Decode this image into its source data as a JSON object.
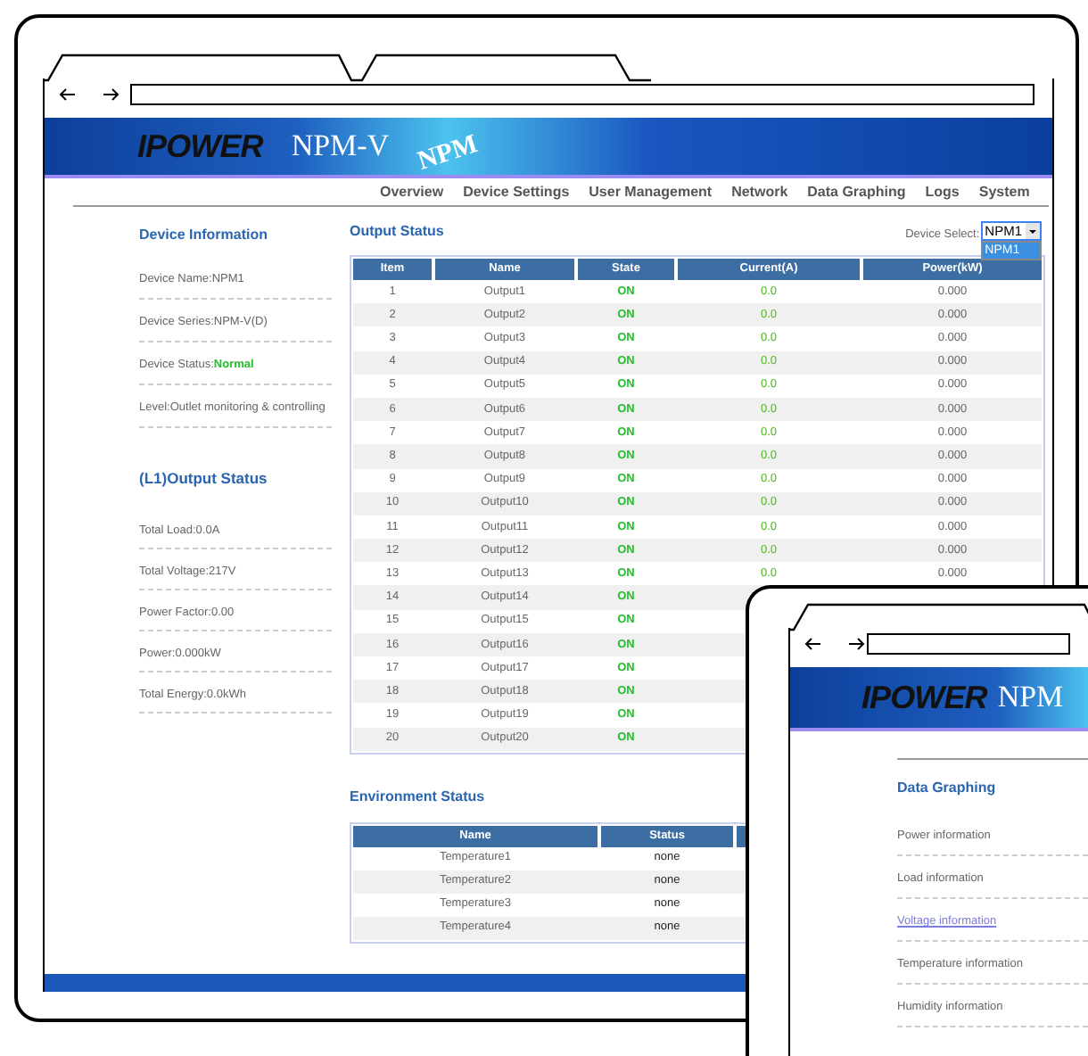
{
  "banner": {
    "logo": "IPOWER",
    "product": "NPM-V",
    "watermark": "NPM"
  },
  "nav": [
    "Overview",
    "Device Settings",
    "User Management",
    "Network",
    "Data Graphing",
    "Logs",
    "System"
  ],
  "device_info": {
    "title": "Device Information",
    "items": [
      "Device Name:NPM1",
      "Device Series:NPM-V(D)",
      "Device Status:**Normal**",
      "Level:Outlet monitoring & controlling"
    ]
  },
  "output_summary": {
    "title": "(L1)Output Status",
    "items": [
      "Total Load:0.0A",
      "Total Voltage:217V",
      "Power Factor:0.00",
      "Power:0.000kW",
      "Total Energy:0.0kWh"
    ]
  },
  "output_status": {
    "title": "Output Status",
    "device_select": {
      "label": "Device Select:",
      "value": "NPM1",
      "expanded": true,
      "options": [
        {
          "label": "NPM1",
          "selected": true
        }
      ]
    },
    "columns": [
      "Item",
      "Name",
      "State",
      "Current(A)",
      "Power(kW)"
    ],
    "rows": [
      {
        "item": "1",
        "name": "Output1",
        "state": "ON",
        "current": "0.0",
        "power": "0.000"
      },
      {
        "item": "2",
        "name": "Output2",
        "state": "ON",
        "current": "0.0",
        "power": "0.000"
      },
      {
        "item": "3",
        "name": "Output3",
        "state": "ON",
        "current": "0.0",
        "power": "0.000"
      },
      {
        "item": "4",
        "name": "Output4",
        "state": "ON",
        "current": "0.0",
        "power": "0.000"
      },
      {
        "item": "5",
        "name": "Output5",
        "state": "ON",
        "current": "0.0",
        "power": "0.000"
      },
      {
        "item": "6",
        "name": "Output6",
        "state": "ON",
        "current": "0.0",
        "power": "0.000"
      },
      {
        "item": "7",
        "name": "Output7",
        "state": "ON",
        "current": "0.0",
        "power": "0.000"
      },
      {
        "item": "8",
        "name": "Output8",
        "state": "ON",
        "current": "0.0",
        "power": "0.000"
      },
      {
        "item": "9",
        "name": "Output9",
        "state": "ON",
        "current": "0.0",
        "power": "0.000"
      },
      {
        "item": "10",
        "name": "Output10",
        "state": "ON",
        "current": "0.0",
        "power": "0.000"
      },
      {
        "item": "11",
        "name": "Output11",
        "state": "ON",
        "current": "0.0",
        "power": "0.000"
      },
      {
        "item": "12",
        "name": "Output12",
        "state": "ON",
        "current": "0.0",
        "power": "0.000"
      },
      {
        "item": "13",
        "name": "Output13",
        "state": "ON",
        "current": "0.0",
        "power": "0.000"
      },
      {
        "item": "14",
        "name": "Output14",
        "state": "ON"
      },
      {
        "item": "15",
        "name": "Output15",
        "state": "ON"
      },
      {
        "item": "16",
        "name": "Output16",
        "state": "ON"
      },
      {
        "item": "17",
        "name": "Output17",
        "state": "ON"
      },
      {
        "item": "18",
        "name": "Output18",
        "state": "ON"
      },
      {
        "item": "19",
        "name": "Output19",
        "state": "ON"
      },
      {
        "item": "20",
        "name": "Output20",
        "state": "ON"
      }
    ]
  },
  "environment_status": {
    "title": "Environment Status",
    "columns": [
      "Name",
      "Status"
    ],
    "rows": [
      {
        "name": "Temperature1",
        "status": "none"
      },
      {
        "name": "Temperature2",
        "status": "none"
      },
      {
        "name": "Temperature3",
        "status": "none"
      },
      {
        "name": "Temperature4",
        "status": "none"
      }
    ]
  },
  "second_window": {
    "banner": {
      "logo": "IPOWER",
      "product": "NPM"
    },
    "title": "Data Graphing",
    "items": [
      {
        "label": "Power information",
        "selected": false
      },
      {
        "label": "Load information",
        "selected": false
      },
      {
        "label": "Voltage information",
        "selected": true
      },
      {
        "label": "Temperature information",
        "selected": false
      },
      {
        "label": "Humidity information",
        "selected": false
      }
    ]
  }
}
